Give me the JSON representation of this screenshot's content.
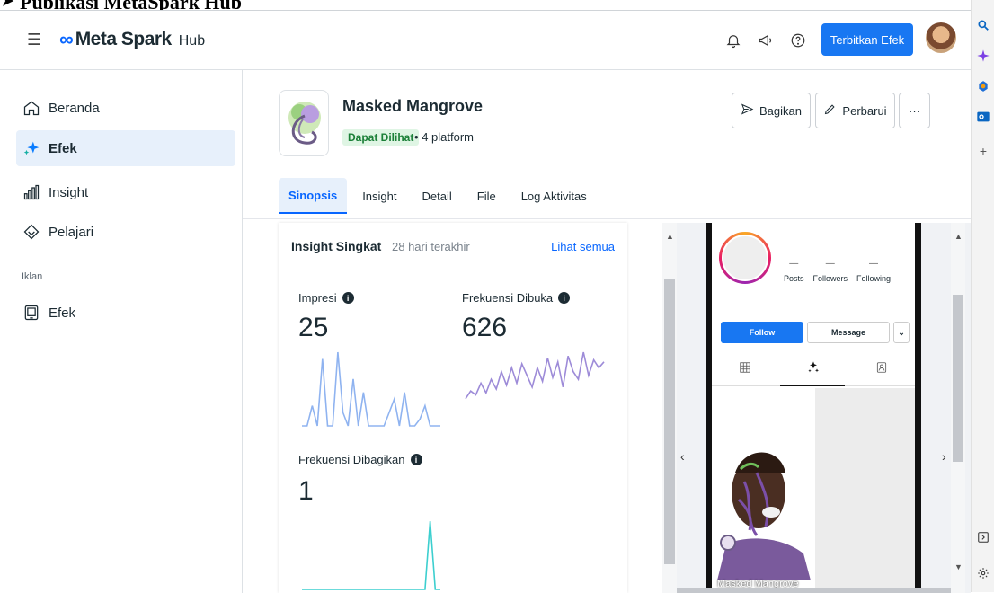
{
  "document": {
    "caption": "Publikasi MetaSpark Hub"
  },
  "topbar": {
    "brand": "Meta Spark",
    "hub": "Hub",
    "publish_label": "Terbitkan Efek",
    "icons": [
      "menu-icon",
      "bell-icon",
      "megaphone-icon",
      "help-icon"
    ]
  },
  "sidebar": {
    "items": [
      {
        "label": "Beranda",
        "icon": "home-icon"
      },
      {
        "label": "Efek",
        "icon": "sparkle-icon",
        "active": true
      },
      {
        "label": "Insight",
        "icon": "bar-chart-icon"
      },
      {
        "label": "Pelajari",
        "icon": "learn-icon"
      }
    ],
    "section_label": "Iklan",
    "ads_items": [
      {
        "label": "Efek",
        "icon": "tablet-icon"
      }
    ]
  },
  "effect": {
    "title": "Masked Mangrove",
    "status": "Dapat Dilihat",
    "separator": "•",
    "platforms": "4 platform"
  },
  "actions": {
    "share_label": "Bagikan",
    "update_label": "Perbarui",
    "more_label": "···"
  },
  "tabs": [
    {
      "label": "Sinopsis",
      "active": true
    },
    {
      "label": "Insight"
    },
    {
      "label": "Detail"
    },
    {
      "label": "File"
    },
    {
      "label": "Log Aktivitas"
    }
  ],
  "insights": {
    "title": "Insight Singkat",
    "period": "28 hari terakhir",
    "see_all": "Lihat semua",
    "info_glyph": "i",
    "metrics": [
      {
        "label": "Impresi",
        "value": "25"
      },
      {
        "label": "Frekuensi Dibuka",
        "value": "626"
      },
      {
        "label": "Frekuensi Dibagikan",
        "value": "1"
      }
    ]
  },
  "chart_data": [
    {
      "type": "line",
      "series": [
        {
          "values": [
            0,
            0,
            3,
            0,
            10,
            0,
            0,
            11,
            2,
            0,
            7,
            0,
            5,
            0,
            0,
            0,
            0,
            2,
            4,
            0,
            5,
            0,
            0,
            1,
            3,
            0,
            0,
            0
          ]
        }
      ]
    },
    {
      "type": "line",
      "series": [
        {
          "values": [
            14,
            18,
            16,
            22,
            17,
            24,
            19,
            28,
            21,
            30,
            22,
            32,
            26,
            20,
            30,
            23,
            35,
            25,
            33,
            20,
            36,
            28,
            24,
            38,
            26,
            34,
            30,
            33
          ]
        }
      ]
    },
    {
      "type": "line",
      "series": [
        {
          "values": [
            0,
            0,
            0,
            0,
            0,
            0,
            0,
            0,
            0,
            0,
            0,
            0,
            0,
            0,
            0,
            0,
            0,
            0,
            0,
            0,
            0,
            0,
            0,
            0,
            0,
            1,
            0,
            0
          ]
        }
      ]
    }
  ],
  "preview": {
    "stats": [
      {
        "label": "Posts",
        "value": "—"
      },
      {
        "label": "Followers",
        "value": "—"
      },
      {
        "label": "Following",
        "value": "—"
      }
    ],
    "follow_label": "Follow",
    "message_label": "Message",
    "dropdown_glyph": "⌄",
    "caption": "Masked Mangrove",
    "prev_glyph": "‹",
    "next_glyph": "›"
  },
  "colors": {
    "primary": "#1877f2",
    "impressions_line": "#8fb3f0",
    "opens_line": "#9d8bd8",
    "shares_line": "#3ccfcf",
    "status_bg": "#dff5e4",
    "status_fg": "#1a7f37"
  }
}
